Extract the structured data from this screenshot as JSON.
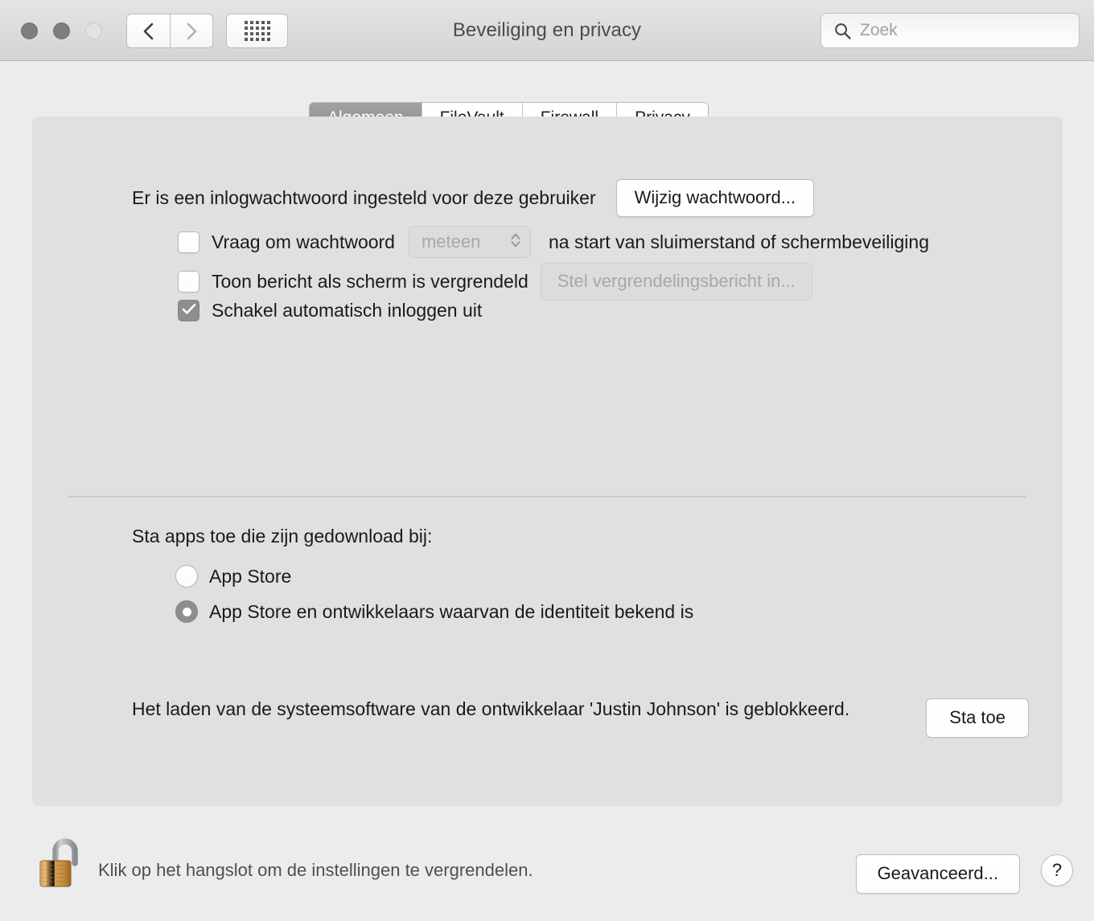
{
  "window": {
    "title": "Beveiliging en privacy",
    "traffic_lights": [
      "close",
      "minimize",
      "zoom"
    ],
    "nav": {
      "back_icon": "chevron-left-icon",
      "forward_icon": "chevron-right-icon",
      "grid_icon": "grid-view-icon"
    },
    "search": {
      "icon": "search-icon",
      "placeholder": "Zoek",
      "value": ""
    }
  },
  "tabs": [
    {
      "label": "Algemeen",
      "active": true
    },
    {
      "label": "FileVault",
      "active": false
    },
    {
      "label": "Firewall",
      "active": false
    },
    {
      "label": "Privacy",
      "active": false
    }
  ],
  "general": {
    "password_status": "Er is een inlogwachtwoord ingesteld voor deze gebruiker",
    "change_password_button": "Wijzig wachtwoord...",
    "require_password": {
      "label": "Vraag om wachtwoord",
      "checked": false,
      "delay_value": "meteen",
      "delay_disabled": true,
      "suffix": "na start van sluimerstand of schermbeveiliging"
    },
    "show_message": {
      "label": "Toon bericht als scherm is vergrendeld",
      "checked": false,
      "button_label": "Stel vergrendelingsbericht in...",
      "button_disabled": true
    },
    "disable_auto_login": {
      "label": "Schakel automatisch inloggen uit",
      "checked": true
    }
  },
  "downloads": {
    "heading": "Sta apps toe die zijn gedownload bij:",
    "options": [
      {
        "label": "App Store",
        "selected": false
      },
      {
        "label": "App Store en ontwikkelaars waarvan de identiteit bekend is",
        "selected": true
      }
    ]
  },
  "blocked": {
    "message": "Het laden van de systeemsoftware van de ontwikkelaar 'Justin Johnson' is geblokkeerd.",
    "allow_button": "Sta toe"
  },
  "footer": {
    "lock_icon": "open-padlock-icon",
    "lock_note": "Klik op het hangslot om de instellingen te vergrendelen.",
    "advanced_button": "Geavanceerd...",
    "help_button": "?"
  },
  "colors": {
    "window_bg": "#ececec",
    "panel_bg": "#e0e0e0",
    "titlebar_top": "#e4e4e4",
    "titlebar_bottom": "#d4d4d4",
    "active_tab": "#8b8b8b",
    "control_gray": "#8e8e8e",
    "disabled_text": "#a8a8a8",
    "text": "#1a1a1a"
  }
}
